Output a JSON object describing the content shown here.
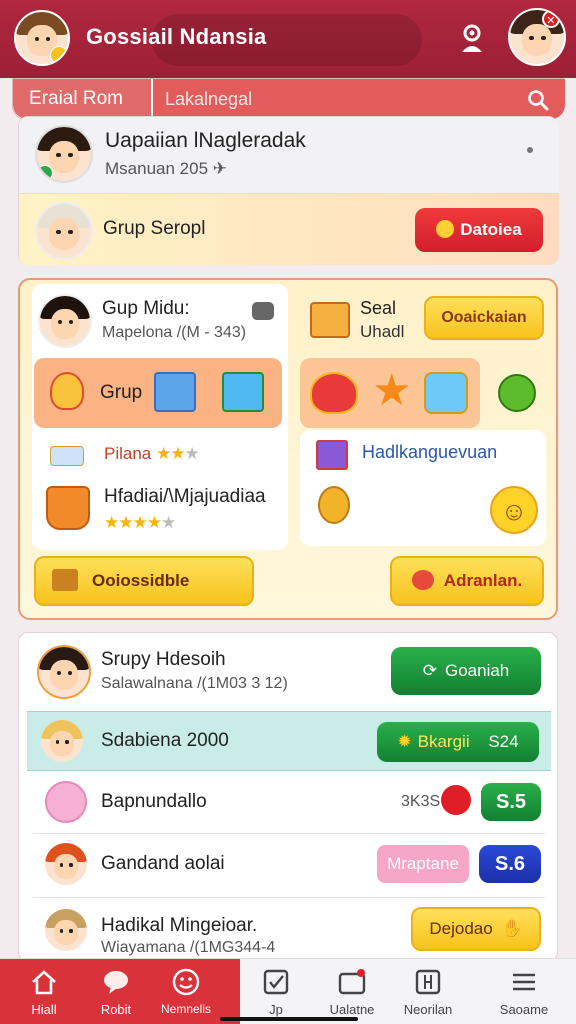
{
  "header": {
    "title": "Gossiail Ndansia",
    "notification_count": "✕"
  },
  "searchbar": {
    "tab_label": "Eraial Rom",
    "placeholder": "Lakalnegal"
  },
  "top_card": {
    "title": "Uapaiian lNagleradak",
    "subtitle": "Msanuan 205 ✈"
  },
  "group_row": {
    "label": "Grup Seropl",
    "button": "Datoiea"
  },
  "panel": {
    "left_title": "Gup Midu:",
    "left_sub": "Mapelona /(M - 343)",
    "band_label": "Grup",
    "right_title": "Seal",
    "right_sub": "Uhadl",
    "right_button": "Ooaickaian",
    "rating1_label": "Pilana",
    "rating1": 2,
    "rating2_label": "Hfadiai/\\Mjajuadiaa",
    "rating2": 4,
    "right_list_label": "Hadlkanguevuan",
    "footer_left": "Ooiossidble",
    "footer_right": "Adranlan."
  },
  "list": [
    {
      "title": "Srupy Hdesoih",
      "sub": "Salawalnana /(1M03 3 12)",
      "button": "Goaniah",
      "kind": "green"
    },
    {
      "title": "Sdabiena 2000",
      "button": "Bkargii",
      "value": "S24",
      "kind": "green-highlight"
    },
    {
      "title": "Bapnundallo",
      "count": "3K3S",
      "value": "S.5",
      "kind": "green-small"
    },
    {
      "title": "Gandand aolai",
      "tag": "Mraptane",
      "value": "S.6",
      "kind": "blue"
    },
    {
      "title": "Hadikal Mingeioar.",
      "sub": "Wiayamana /(1MG344-4",
      "button": "Dejodao",
      "kind": "yellow"
    }
  ],
  "bottom_nav": [
    {
      "label": "Hiall",
      "icon": "home-icon"
    },
    {
      "label": "Robit",
      "icon": "chat-icon"
    },
    {
      "label": "Nemnelis",
      "icon": "smile-icon"
    },
    {
      "label": "Jp",
      "icon": "checkbox-icon"
    },
    {
      "label": "Ualatne",
      "icon": "inbox-icon"
    },
    {
      "label": "Neorilan",
      "icon": "grid-icon"
    },
    {
      "label": "Saoame",
      "icon": "menu-icon"
    }
  ],
  "colors": {
    "brand": "#a8243b",
    "accent_red": "#e06a6a",
    "green": "#1e9a3e",
    "yellow": "#f7c21c"
  }
}
